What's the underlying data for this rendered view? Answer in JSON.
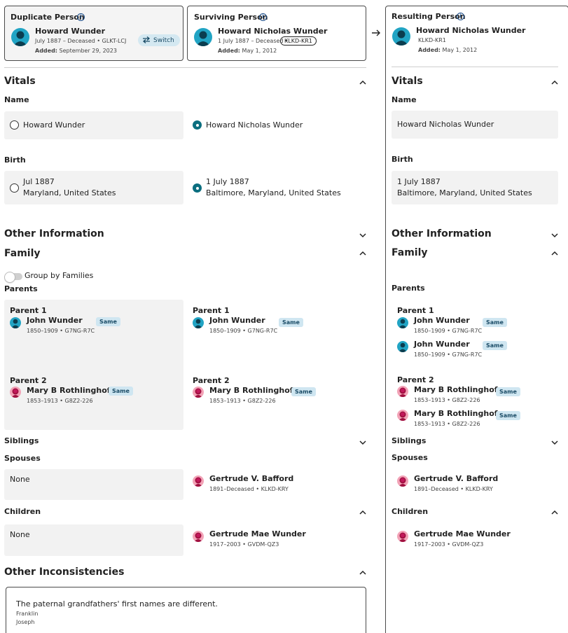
{
  "header": {
    "duplicate": {
      "title": "Duplicate Person",
      "name": "Howard Wunder",
      "meta": "July 1887 – Deceased • GLKT-LCJ",
      "added_label": "Added:",
      "added": "September 29, 2023",
      "switch_label": "Switch"
    },
    "surviving": {
      "title": "Surviving Person",
      "name": "Howard Nicholas Wunder",
      "meta": "1 July 1887 – Deceased •",
      "id": "KLKD-KR1",
      "added_label": "Added:",
      "added": "May 1, 2012"
    },
    "resulting": {
      "title": "Resulting Person",
      "name": "Howard Nicholas Wunder",
      "meta": "KLKD-KR1",
      "added_label": "Added:",
      "added": "May 1, 2012"
    }
  },
  "vitals": {
    "title": "Vitals",
    "name_label": "Name",
    "name_left": "Howard Wunder",
    "name_right": "Howard Nicholas Wunder",
    "name_result": "Howard Nicholas Wunder",
    "birth_label": "Birth",
    "birth_left_date": "Jul 1887",
    "birth_left_place": "Maryland, United States",
    "birth_right_date": "1 July 1887",
    "birth_right_place": "Baltimore, Maryland, United States",
    "birth_result_date": "1 July 1887",
    "birth_result_place": "Baltimore, Maryland, United States"
  },
  "other_info": {
    "title": "Other Information"
  },
  "family": {
    "title": "Family",
    "group_toggle": "Group by Families",
    "parents_label": "Parents",
    "parent1_label": "Parent 1",
    "parent2_label": "Parent 2",
    "father": {
      "name": "John Wunder",
      "meta": "1850–1909 • G7NG-R7C"
    },
    "mother": {
      "name": "Mary B Rothlinghofer",
      "meta": "1853–1913 • G8Z2-226"
    },
    "same_badge": "Same",
    "siblings_label": "Siblings",
    "spouses_label": "Spouses",
    "spouse_none": "None",
    "spouse": {
      "name": "Gertrude V. Bafford",
      "meta": "1891–Deceased • KLKD-KRY"
    },
    "children_label": "Children",
    "children_none": "None",
    "child": {
      "name": "Gertrude Mae Wunder",
      "meta": "1917–2003 • GVDM-QZ3"
    }
  },
  "inconsistencies": {
    "title": "Other Inconsistencies",
    "message": "The paternal grandfathers' first names are different.",
    "value1": "Franklin",
    "value2": "Joseph"
  },
  "colors": {
    "accent": "#0b6e7f",
    "badge_bg": "#cfe6f1",
    "male": "#0e7a96",
    "female": "#c2185b"
  }
}
